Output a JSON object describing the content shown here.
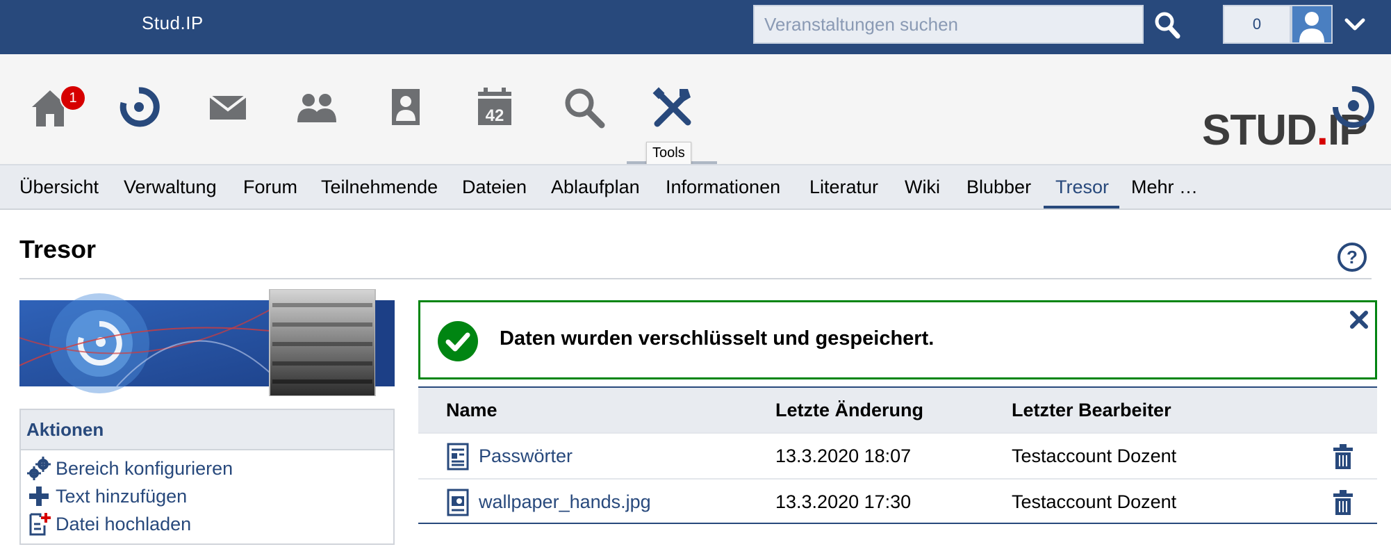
{
  "topbar": {
    "brand": "Stud.IP",
    "search_placeholder": "Veranstaltungen suchen",
    "search_icon": "magnifier-icon",
    "notification_count": "0",
    "avatar_icon": "user-avatar-icon",
    "menu_icon": "chevron-down-icon"
  },
  "iconnav": {
    "items": [
      {
        "name": "home",
        "icon": "home-icon",
        "badge": "1"
      },
      {
        "name": "my-courses",
        "icon": "seminar-icon"
      },
      {
        "name": "messages",
        "icon": "mail-icon"
      },
      {
        "name": "community",
        "icon": "community-icon"
      },
      {
        "name": "profile",
        "icon": "person-icon"
      },
      {
        "name": "schedule",
        "icon": "calendar-icon",
        "calendar_number": "42"
      },
      {
        "name": "search",
        "icon": "search-icon"
      },
      {
        "name": "tools",
        "icon": "tools-icon",
        "tooltip": "Tools"
      }
    ],
    "logo_text_main": "STUD",
    "logo_text_dot": ".",
    "logo_text_ip": "IP"
  },
  "tabs": [
    {
      "label": "Übersicht"
    },
    {
      "label": "Verwaltung"
    },
    {
      "label": "Forum"
    },
    {
      "label": "Teilnehmende"
    },
    {
      "label": "Dateien"
    },
    {
      "label": "Ablaufplan"
    },
    {
      "label": "Informationen"
    },
    {
      "label": "Literatur"
    },
    {
      "label": "Wiki"
    },
    {
      "label": "Blubber"
    },
    {
      "label": "Tresor",
      "active": true
    },
    {
      "label": "Mehr …"
    }
  ],
  "page": {
    "title": "Tresor",
    "help_icon": "help-icon"
  },
  "sidebar": {
    "actions_title": "Aktionen",
    "actions": [
      {
        "label": "Bereich konfigurieren",
        "icon": "gears-icon"
      },
      {
        "label": "Text hinzufügen",
        "icon": "plus-icon"
      },
      {
        "label": "Datei hochladen",
        "icon": "file-add-icon"
      }
    ]
  },
  "message": {
    "text": "Daten wurden verschlüsselt und gespeichert.",
    "status_color": "#008512"
  },
  "table": {
    "headers": [
      "Name",
      "Letzte Änderung",
      "Letzter Bearbeiter"
    ],
    "rows": [
      {
        "name": "Passwörter",
        "changed": "13.3.2020 18:07",
        "editor": "Testaccount Dozent",
        "icon": "text-file-icon"
      },
      {
        "name": "wallpaper_hands.jpg",
        "changed": "13.3.2020 17:30",
        "editor": "Testaccount Dozent",
        "icon": "image-file-icon"
      }
    ]
  },
  "colors": {
    "brand_blue": "#28497c",
    "success_green": "#008512",
    "badge_red": "#d60000"
  }
}
